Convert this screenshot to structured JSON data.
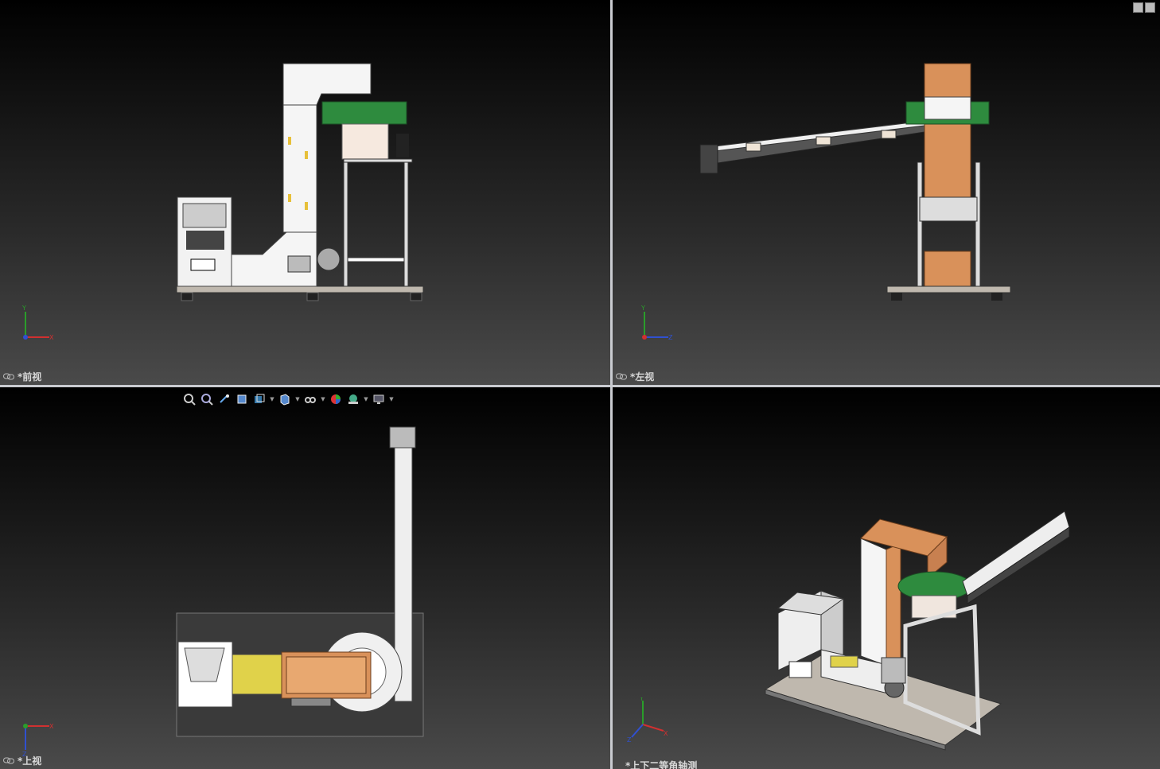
{
  "viewports": {
    "front": {
      "label": "*前视"
    },
    "left": {
      "label": "*左视"
    },
    "top": {
      "label": "*上视"
    },
    "iso": {
      "label": "*上下二等角轴测"
    }
  },
  "axes": {
    "x": "X",
    "y": "Y",
    "z": "Z"
  },
  "toolbar": {
    "items": [
      "zoom-to-fit-icon",
      "zoom-area-icon",
      "previous-view-icon",
      "section-view-icon",
      "view-orientation-icon",
      "display-style-icon",
      "hide-show-items-icon",
      "edit-appearance-icon",
      "apply-scene-icon",
      "view-settings-icon"
    ]
  },
  "colors": {
    "frame": "#e8e8e8",
    "green_ring": "#2e8b3e",
    "belt": "#d9915a",
    "separator": "#c9cbd0",
    "bg_top": "#000000",
    "bg_bottom": "#4a4a4a"
  }
}
